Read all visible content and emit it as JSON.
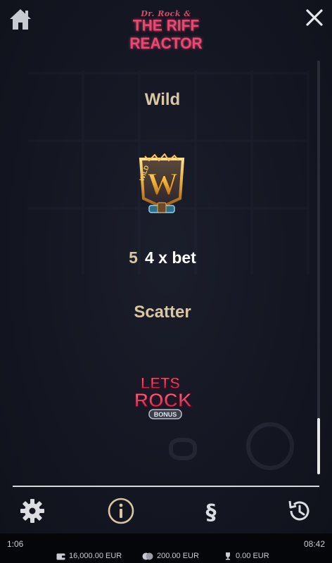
{
  "header": {
    "logo_sub": "Dr. Rock &",
    "logo_main": "THE RIFF REACTOR",
    "home_icon": "home-icon",
    "close_icon": "close-icon"
  },
  "paytable": {
    "wild": {
      "title": "Wild",
      "symbol_icon": "wild-symbol-icon",
      "symbol_text": "W",
      "symbol_tag": "WILD",
      "payout_count": "5",
      "payout_value": "4 x bet"
    },
    "scatter": {
      "title": "Scatter",
      "symbol_icon": "lets-rock-bonus-icon",
      "symbol_line1": "LETS",
      "symbol_line2": "ROCK",
      "symbol_tag": "BONUS"
    }
  },
  "toolbar": {
    "settings_icon": "gear-icon",
    "info_icon": "info-icon",
    "rules_icon": "section-icon",
    "history_icon": "history-icon"
  },
  "status": {
    "elapsed": "1:06",
    "clock": "08:42",
    "balance": "16,000.00 EUR",
    "bet": "200.00 EUR",
    "win": "0.00 EUR"
  },
  "colors": {
    "heading": "#d9c7a4",
    "logo": "#e64a73",
    "background": "#141622"
  }
}
